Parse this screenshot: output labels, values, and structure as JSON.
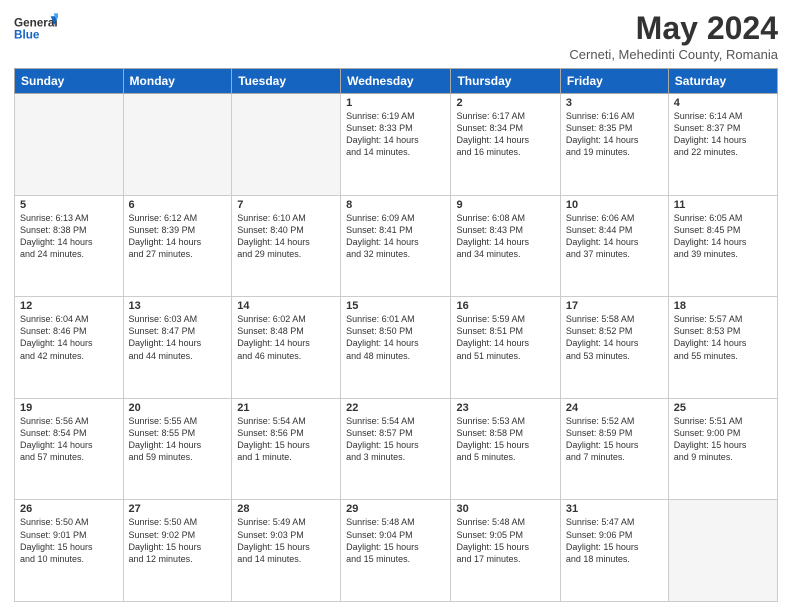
{
  "header": {
    "logo_line1": "General",
    "logo_line2": "Blue",
    "main_title": "May 2024",
    "subtitle": "Cerneti, Mehedinti County, Romania"
  },
  "weekdays": [
    "Sunday",
    "Monday",
    "Tuesday",
    "Wednesday",
    "Thursday",
    "Friday",
    "Saturday"
  ],
  "weeks": [
    [
      {
        "day": "",
        "info": ""
      },
      {
        "day": "",
        "info": ""
      },
      {
        "day": "",
        "info": ""
      },
      {
        "day": "1",
        "info": "Sunrise: 6:19 AM\nSunset: 8:33 PM\nDaylight: 14 hours\nand 14 minutes."
      },
      {
        "day": "2",
        "info": "Sunrise: 6:17 AM\nSunset: 8:34 PM\nDaylight: 14 hours\nand 16 minutes."
      },
      {
        "day": "3",
        "info": "Sunrise: 6:16 AM\nSunset: 8:35 PM\nDaylight: 14 hours\nand 19 minutes."
      },
      {
        "day": "4",
        "info": "Sunrise: 6:14 AM\nSunset: 8:37 PM\nDaylight: 14 hours\nand 22 minutes."
      }
    ],
    [
      {
        "day": "5",
        "info": "Sunrise: 6:13 AM\nSunset: 8:38 PM\nDaylight: 14 hours\nand 24 minutes."
      },
      {
        "day": "6",
        "info": "Sunrise: 6:12 AM\nSunset: 8:39 PM\nDaylight: 14 hours\nand 27 minutes."
      },
      {
        "day": "7",
        "info": "Sunrise: 6:10 AM\nSunset: 8:40 PM\nDaylight: 14 hours\nand 29 minutes."
      },
      {
        "day": "8",
        "info": "Sunrise: 6:09 AM\nSunset: 8:41 PM\nDaylight: 14 hours\nand 32 minutes."
      },
      {
        "day": "9",
        "info": "Sunrise: 6:08 AM\nSunset: 8:43 PM\nDaylight: 14 hours\nand 34 minutes."
      },
      {
        "day": "10",
        "info": "Sunrise: 6:06 AM\nSunset: 8:44 PM\nDaylight: 14 hours\nand 37 minutes."
      },
      {
        "day": "11",
        "info": "Sunrise: 6:05 AM\nSunset: 8:45 PM\nDaylight: 14 hours\nand 39 minutes."
      }
    ],
    [
      {
        "day": "12",
        "info": "Sunrise: 6:04 AM\nSunset: 8:46 PM\nDaylight: 14 hours\nand 42 minutes."
      },
      {
        "day": "13",
        "info": "Sunrise: 6:03 AM\nSunset: 8:47 PM\nDaylight: 14 hours\nand 44 minutes."
      },
      {
        "day": "14",
        "info": "Sunrise: 6:02 AM\nSunset: 8:48 PM\nDaylight: 14 hours\nand 46 minutes."
      },
      {
        "day": "15",
        "info": "Sunrise: 6:01 AM\nSunset: 8:50 PM\nDaylight: 14 hours\nand 48 minutes."
      },
      {
        "day": "16",
        "info": "Sunrise: 5:59 AM\nSunset: 8:51 PM\nDaylight: 14 hours\nand 51 minutes."
      },
      {
        "day": "17",
        "info": "Sunrise: 5:58 AM\nSunset: 8:52 PM\nDaylight: 14 hours\nand 53 minutes."
      },
      {
        "day": "18",
        "info": "Sunrise: 5:57 AM\nSunset: 8:53 PM\nDaylight: 14 hours\nand 55 minutes."
      }
    ],
    [
      {
        "day": "19",
        "info": "Sunrise: 5:56 AM\nSunset: 8:54 PM\nDaylight: 14 hours\nand 57 minutes."
      },
      {
        "day": "20",
        "info": "Sunrise: 5:55 AM\nSunset: 8:55 PM\nDaylight: 14 hours\nand 59 minutes."
      },
      {
        "day": "21",
        "info": "Sunrise: 5:54 AM\nSunset: 8:56 PM\nDaylight: 15 hours\nand 1 minute."
      },
      {
        "day": "22",
        "info": "Sunrise: 5:54 AM\nSunset: 8:57 PM\nDaylight: 15 hours\nand 3 minutes."
      },
      {
        "day": "23",
        "info": "Sunrise: 5:53 AM\nSunset: 8:58 PM\nDaylight: 15 hours\nand 5 minutes."
      },
      {
        "day": "24",
        "info": "Sunrise: 5:52 AM\nSunset: 8:59 PM\nDaylight: 15 hours\nand 7 minutes."
      },
      {
        "day": "25",
        "info": "Sunrise: 5:51 AM\nSunset: 9:00 PM\nDaylight: 15 hours\nand 9 minutes."
      }
    ],
    [
      {
        "day": "26",
        "info": "Sunrise: 5:50 AM\nSunset: 9:01 PM\nDaylight: 15 hours\nand 10 minutes."
      },
      {
        "day": "27",
        "info": "Sunrise: 5:50 AM\nSunset: 9:02 PM\nDaylight: 15 hours\nand 12 minutes."
      },
      {
        "day": "28",
        "info": "Sunrise: 5:49 AM\nSunset: 9:03 PM\nDaylight: 15 hours\nand 14 minutes."
      },
      {
        "day": "29",
        "info": "Sunrise: 5:48 AM\nSunset: 9:04 PM\nDaylight: 15 hours\nand 15 minutes."
      },
      {
        "day": "30",
        "info": "Sunrise: 5:48 AM\nSunset: 9:05 PM\nDaylight: 15 hours\nand 17 minutes."
      },
      {
        "day": "31",
        "info": "Sunrise: 5:47 AM\nSunset: 9:06 PM\nDaylight: 15 hours\nand 18 minutes."
      },
      {
        "day": "",
        "info": ""
      }
    ]
  ]
}
